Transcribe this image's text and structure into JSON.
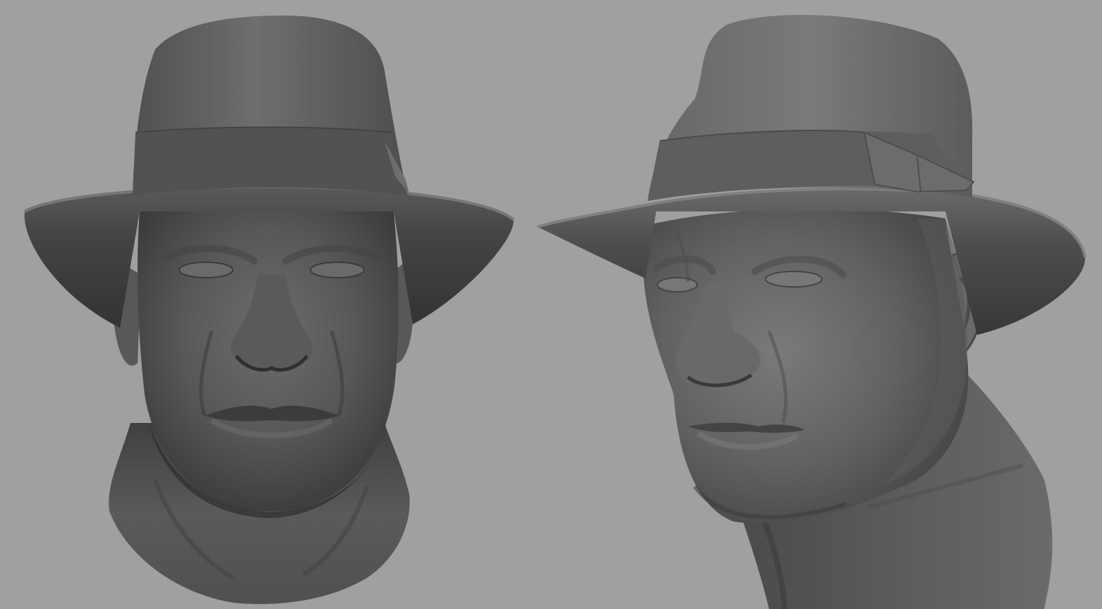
{
  "viewport": {
    "background": "#a0a0a0"
  },
  "render": {
    "style": "grey-clay-shaded",
    "subject": "male-head-with-fedora",
    "views": [
      "front-view",
      "three-quarter-view"
    ]
  },
  "colors": {
    "clay_light": "#7a7a7a",
    "clay_mid": "#5c5c5c",
    "clay_dark": "#3e3e3e",
    "clay_shadow": "#2e2e2e"
  }
}
